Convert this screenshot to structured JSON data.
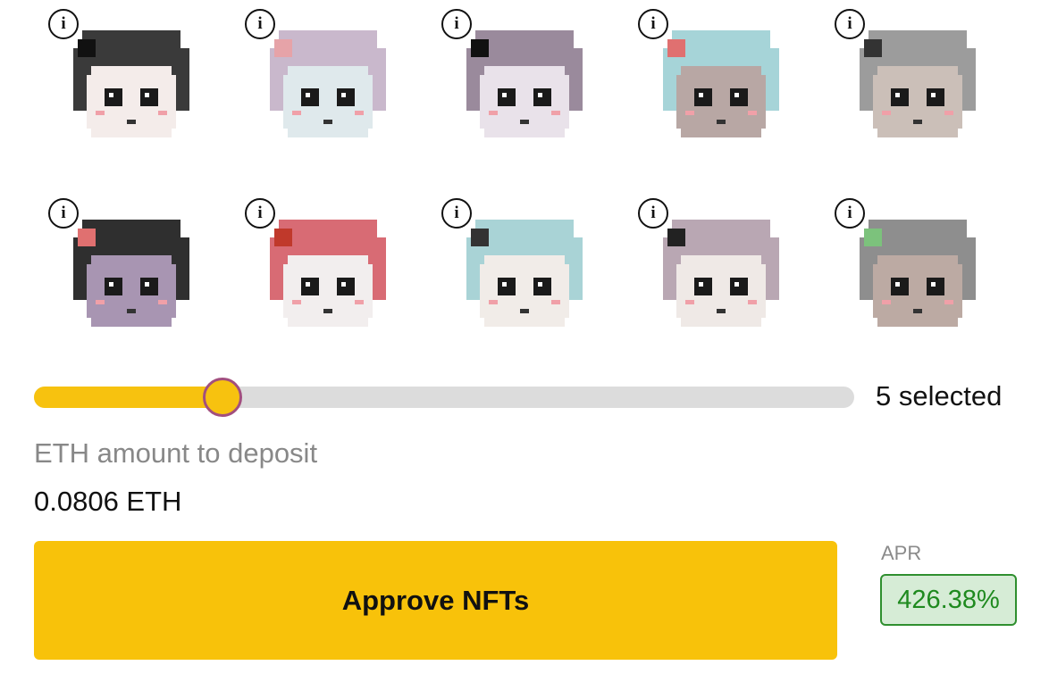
{
  "nfts": [
    {
      "name": "avatar-sunglasses-dark-hair",
      "icon": "info-icon",
      "hair": "#3a3a3a",
      "skin": "#f4ecea",
      "accent": "#111111"
    },
    {
      "name": "avatar-lavender-bunny",
      "icon": "info-icon",
      "hair": "#c9b8cc",
      "skin": "#dfe9ec",
      "accent": "#e6a3a8"
    },
    {
      "name": "avatar-black-cap",
      "icon": "info-icon",
      "hair": "#9a8a9c",
      "skin": "#e9e2ea",
      "accent": "#111111"
    },
    {
      "name": "avatar-cyan-flower",
      "icon": "info-icon",
      "hair": "#a6d4d8",
      "skin": "#b8a7a4",
      "accent": "#e07070"
    },
    {
      "name": "avatar-gray-fox",
      "icon": "info-icon",
      "hair": "#9c9c9c",
      "skin": "#cbbfb8",
      "accent": "#333333"
    },
    {
      "name": "avatar-purple-flower",
      "icon": "info-icon",
      "hair": "#2f2f2f",
      "skin": "#a895b2",
      "accent": "#e07070"
    },
    {
      "name": "avatar-strawberry-hood",
      "icon": "info-icon",
      "hair": "#d86b74",
      "skin": "#f2eeee",
      "accent": "#c0392b"
    },
    {
      "name": "avatar-white-hat",
      "icon": "info-icon",
      "hair": "#a9d3d6",
      "skin": "#f1ece8",
      "accent": "#333333"
    },
    {
      "name": "avatar-squint-lavender",
      "icon": "info-icon",
      "hair": "#b9a7b3",
      "skin": "#efe9e6",
      "accent": "#222222"
    },
    {
      "name": "avatar-green-leaf",
      "icon": "info-icon",
      "hair": "#8e8e8e",
      "skin": "#bcaaa3",
      "accent": "#7cc27c"
    }
  ],
  "slider": {
    "fraction": 0.23
  },
  "selected_count": "5 selected",
  "deposit": {
    "label": "ETH amount to deposit",
    "value": "0.0806 ETH"
  },
  "approve_button_label": "Approve NFTs",
  "apr": {
    "label": "APR",
    "value": "426.38%"
  },
  "colors": {
    "accent": "#f8c20a",
    "track": "#dcdcdc",
    "thumb_border": "#a24f7e",
    "apr_text": "#1f8a1f",
    "apr_bg": "#d6ecd6"
  }
}
